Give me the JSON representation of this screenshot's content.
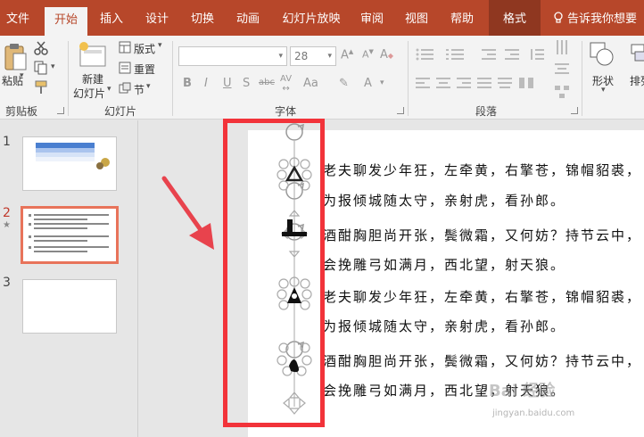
{
  "tabs": [
    "文件",
    "开始",
    "插入",
    "设计",
    "切换",
    "动画",
    "幻灯片放映",
    "审阅",
    "视图",
    "帮助",
    "格式"
  ],
  "tell_me": "告诉我你想要",
  "ribbon": {
    "paste": "粘贴",
    "clipboard_group": "剪贴板",
    "new_slide_line1": "新建",
    "new_slide_line2": "幻灯片",
    "layout": "版式",
    "reset": "重置",
    "section": "节",
    "slides_group": "幻灯片",
    "font_size": "28",
    "font_group": "字体",
    "paragraph_group": "段落",
    "shape": "形状",
    "arrange": "排列"
  },
  "thumbnails": [
    {
      "number": "1"
    },
    {
      "number": "2",
      "star": "★"
    },
    {
      "number": "3"
    }
  ],
  "poem_lines": [
    "老夫聊发少年狂，左牵黄，右擎苍，锦帽貂裘，",
    "为报倾城随太守，亲射虎，看孙郎。",
    "酒酣胸胆尚开张，鬓微霜，又何妨？持节云中，",
    "会挽雕弓如满月，西北望，射天狼。",
    "老夫聊发少年狂，左牵黄，右擎苍，锦帽貂裘，",
    "为报倾城随太守，亲射虎，看孙郎。",
    "酒酣胸胆尚开张，鬓微霜，又何妨？持节云中，",
    "会挽雕弓如满月，西北望，射天狼。"
  ],
  "watermark": "Bai 经验",
  "watermark_url": "jingyan.baidu.com",
  "colors": {
    "accent": "#b7472a",
    "highlight": "#f2333a",
    "arrow": "#e8434d"
  }
}
